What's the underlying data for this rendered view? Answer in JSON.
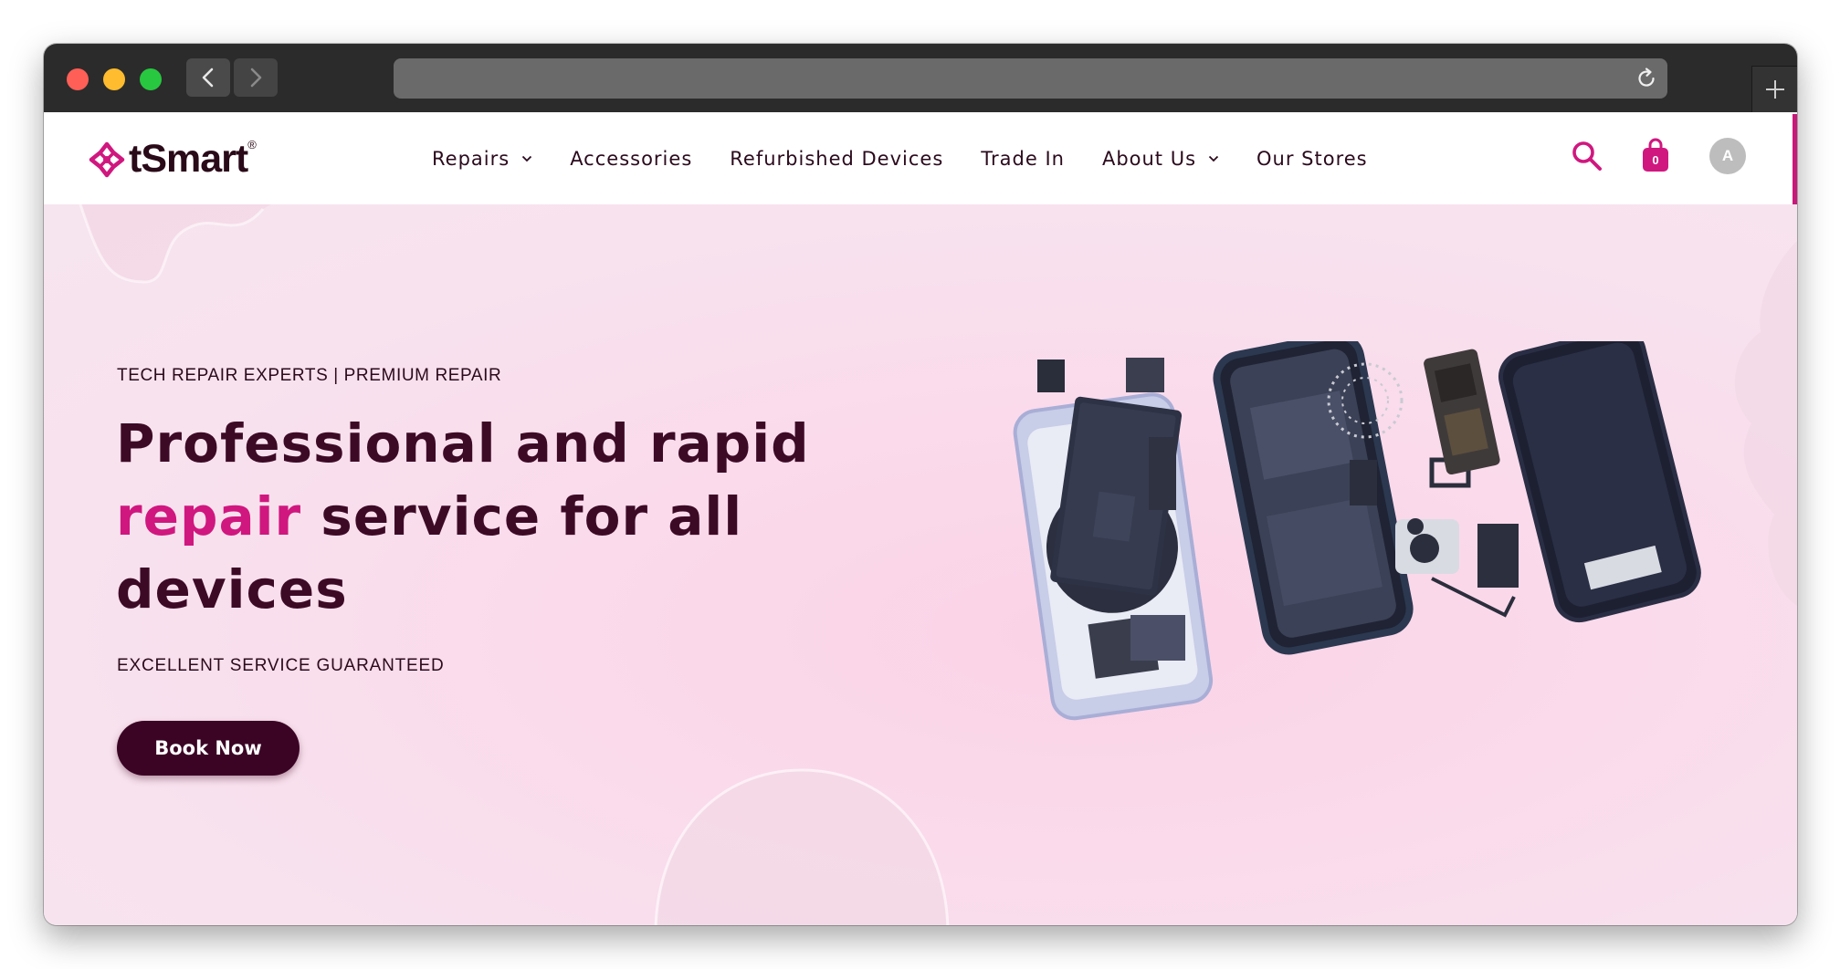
{
  "header": {
    "logo_text": "tSmart",
    "logo_reg": "®",
    "nav": [
      {
        "label": "Repairs",
        "has_dropdown": true
      },
      {
        "label": "Accessories",
        "has_dropdown": false
      },
      {
        "label": "Refurbished Devices",
        "has_dropdown": false
      },
      {
        "label": "Trade In",
        "has_dropdown": false
      },
      {
        "label": "About Us",
        "has_dropdown": true
      },
      {
        "label": "Our Stores",
        "has_dropdown": false
      }
    ],
    "cart_count": "0",
    "avatar_initial": "A"
  },
  "hero": {
    "eyebrow": "TECH REPAIR EXPERTS | PREMIUM REPAIR",
    "headline_part1": "Professional and rapid",
    "headline_accent": "repair",
    "headline_part2": "service for all devices",
    "subline": "EXCELLENT SERVICE GUARANTEED",
    "cta_label": "Book Now"
  },
  "icons": {
    "back": "chevron-left-icon",
    "forward": "chevron-right-icon",
    "reload": "reload-icon",
    "new_tab": "plus-icon",
    "search": "search-icon",
    "cart": "shopping-bag-icon"
  },
  "colors": {
    "brand_magenta": "#d0177f",
    "brand_dark": "#3b0424",
    "hero_bg": "#f8e2ee"
  }
}
